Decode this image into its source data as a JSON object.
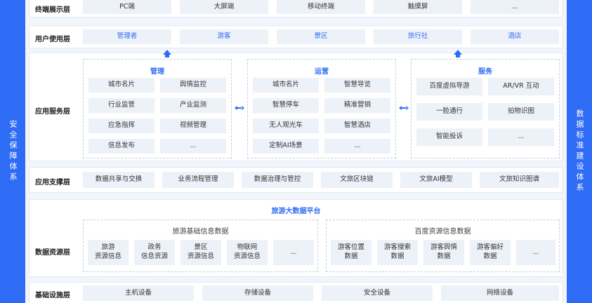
{
  "side": {
    "left": "安全保障体系",
    "right": "数据标准建设体系"
  },
  "layers": {
    "terminal": {
      "label": "终端展示层",
      "items": [
        "PC端",
        "大屏端",
        "移动终端",
        "触摸屏",
        "..."
      ]
    },
    "user": {
      "label": "用户使用层",
      "items": [
        "管理者",
        "游客",
        "景区",
        "旅行社",
        "酒店"
      ]
    },
    "app_service": {
      "label": "应用服务层",
      "groups": [
        {
          "title": "管理",
          "items": [
            "城市名片",
            "舆情监控",
            "行业监管",
            "产业监测",
            "应急指挥",
            "视频管理",
            "信息发布",
            "..."
          ]
        },
        {
          "title": "运营",
          "items": [
            "城市名片",
            "智慧导览",
            "智慧停车",
            "精准营销",
            "无人观光车",
            "智慧酒店",
            "定制AI场景",
            "..."
          ]
        },
        {
          "title": "服务",
          "items": [
            "百度虚拟导游",
            "AR/VR 互动",
            "一脸通行",
            "拍物识图",
            "智能投诉",
            "..."
          ]
        }
      ]
    },
    "app_support": {
      "label": "应用支撑层",
      "items": [
        "数据共享与交换",
        "业务流程管理",
        "数据治理与管控",
        "文旅区块链",
        "文旅AI模型",
        "文旅知识图谱"
      ]
    },
    "data_resource": {
      "label": "数据资源层",
      "platform": "旅游大数据平台",
      "groups": [
        {
          "title": "旅游基础信息数据",
          "items": [
            "旅游\n资源信息",
            "政务\n信息资源",
            "景区\n资源信息",
            "物联网\n资源信息",
            "..."
          ]
        },
        {
          "title": "百度资源信息数据",
          "items": [
            "游客位置\n数据",
            "游客搜索\n数据",
            "游客舆情\n数据",
            "游客偏好\n数据",
            "..."
          ]
        }
      ]
    },
    "infra": {
      "label": "基础设施层",
      "items": [
        "主机设备",
        "存储设备",
        "安全设备",
        "网络设备"
      ]
    }
  },
  "colors": {
    "accent": "#2f6cf5",
    "cell": "#edf1f8",
    "background": "#f2f5fb"
  }
}
